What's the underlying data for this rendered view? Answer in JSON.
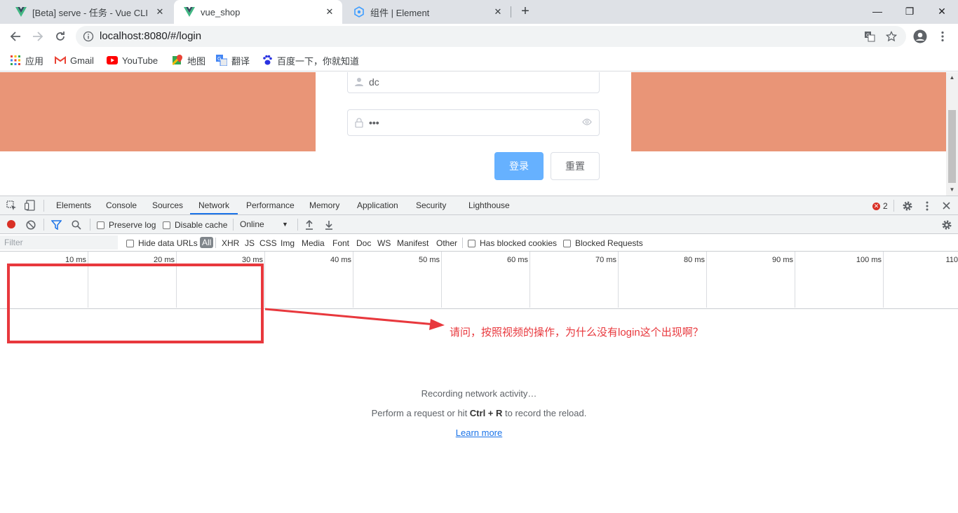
{
  "browser": {
    "tabs": [
      {
        "title": "[Beta] serve - 任务 - Vue CLI",
        "icon": "vue-logo"
      },
      {
        "title": "vue_shop",
        "icon": "vue-logo",
        "active": true
      },
      {
        "title": "组件 | Element",
        "icon": "element-logo"
      }
    ],
    "new_tab": "+",
    "window_controls": {
      "minimize": "—",
      "maximize": "❐",
      "close": "✕"
    },
    "url": "localhost:8080/#/login",
    "bookmarks": [
      {
        "label": "应用",
        "icon": "apps-grid-icon"
      },
      {
        "label": "Gmail",
        "icon": "gmail-icon"
      },
      {
        "label": "YouTube",
        "icon": "youtube-icon"
      },
      {
        "label": "地图",
        "icon": "maps-icon"
      },
      {
        "label": "翻译",
        "icon": "translate-icon"
      },
      {
        "label": "百度一下，你就知道",
        "icon": "baidu-icon"
      }
    ]
  },
  "page": {
    "username_value": "dc",
    "password_value": "•••",
    "login_button": "登录",
    "reset_button": "重置",
    "accent_color": "#e99577"
  },
  "devtools": {
    "tabs": [
      "Elements",
      "Console",
      "Sources",
      "Network",
      "Performance",
      "Memory",
      "Application",
      "Security",
      "Lighthouse"
    ],
    "active_tab": "Network",
    "error_count": "2",
    "toolbar": {
      "preserve_log": "Preserve log",
      "disable_cache": "Disable cache",
      "throttling": "Online"
    },
    "filter": {
      "placeholder": "Filter",
      "hide_data_urls": "Hide data URLs",
      "types": [
        "All",
        "XHR",
        "JS",
        "CSS",
        "Img",
        "Media",
        "Font",
        "Doc",
        "WS",
        "Manifest",
        "Other"
      ],
      "has_blocked_cookies": "Has blocked cookies",
      "blocked_requests": "Blocked Requests"
    },
    "timeline_ticks": [
      "10 ms",
      "20 ms",
      "30 ms",
      "40 ms",
      "50 ms",
      "60 ms",
      "70 ms",
      "80 ms",
      "90 ms",
      "100 ms",
      "110"
    ],
    "empty_state": {
      "line1": "Recording network activity…",
      "line2_prefix": "Perform a request or hit ",
      "line2_keys": "Ctrl + R",
      "line2_suffix": " to record the reload.",
      "learn_more": "Learn more"
    }
  },
  "annotation": {
    "text": "请问，按照视频的操作，为什么没有login这个出现啊？",
    "color": "#e8383d"
  }
}
